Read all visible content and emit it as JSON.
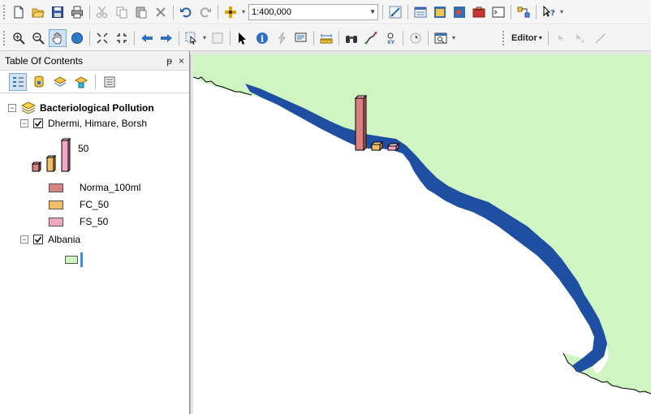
{
  "toolbar": {
    "scale_value": "1:400,000",
    "editor_label": "Editor"
  },
  "toc": {
    "title": "Table Of Contents",
    "pin_glyph": "ᵽ",
    "close_glyph": "×",
    "group_layer": {
      "name": "Bacteriological Pollution",
      "expanded": true
    },
    "layer1": {
      "name": "Dhermi, Himare, Borsh",
      "checked": true,
      "size_label": "50",
      "fields": [
        {
          "label": "Norma_100ml",
          "color": "#d98080"
        },
        {
          "label": "FC_50",
          "color": "#f0bf68"
        },
        {
          "label": "FS_50",
          "color": "#f2a7c4"
        }
      ]
    },
    "layer2": {
      "name": "Albania",
      "checked": true,
      "fill_color": "#cff5c2",
      "marker_color": "#3a8fe0"
    }
  },
  "map": {
    "land_color": "#cff5c2",
    "water_color": "#1f4fa3",
    "bar_colors": {
      "norma": "#d98080",
      "fc": "#f0bf68",
      "fs": "#f2a7c4"
    },
    "bar_values": {
      "norma": 50,
      "fc": 6,
      "fs": 4
    }
  },
  "icons": {
    "new": "new-document-icon",
    "open": "open-folder-icon",
    "save": "save-icon",
    "print": "print-icon",
    "cut": "cut-icon",
    "copy": "copy-icon",
    "paste": "paste-icon",
    "delete": "delete-icon",
    "undo": "undo-icon",
    "redo": "redo-icon",
    "add_data": "add-data-icon",
    "help": "whats-this-icon"
  }
}
